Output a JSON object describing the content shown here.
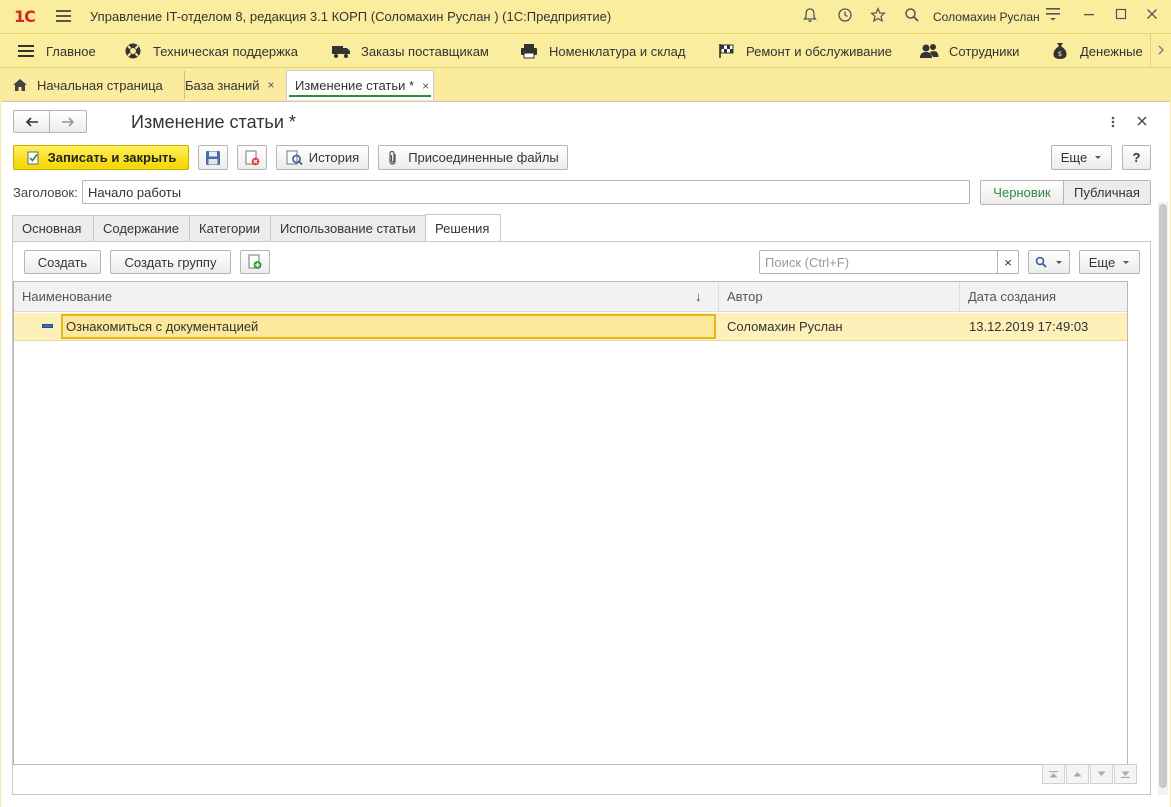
{
  "app": {
    "logo": "1С",
    "title": "Управление IT-отделом 8, редакция 3.1 КОРП (Соломахин Руслан )  (1С:Предприятие)",
    "user": "Соломахин Руслан"
  },
  "sections": [
    {
      "label": "Главное",
      "icon": "menu-icon"
    },
    {
      "label": "Техническая поддержка",
      "icon": "lifebuoy-icon"
    },
    {
      "label": "Заказы поставщикам",
      "icon": "truck-icon"
    },
    {
      "label": "Номенклатура и склад",
      "icon": "printer-icon"
    },
    {
      "label": "Ремонт и обслуживание",
      "icon": "flag-icon"
    },
    {
      "label": "Сотрудники",
      "icon": "people-icon"
    },
    {
      "label": "Денежные",
      "icon": "money-bag-icon"
    }
  ],
  "open_tabs": [
    {
      "label": "Начальная страница"
    },
    {
      "label": "База знаний",
      "close": "×"
    },
    {
      "label": "Изменение статьи *",
      "close": "×"
    }
  ],
  "form": {
    "title": "Изменение статьи *",
    "save_close": "Записать и закрыть",
    "history": "История",
    "attached_files": "Присоединенные файлы",
    "more": "Еще",
    "help": "?",
    "heading_label": "Заголовок:",
    "heading_value": "Начало работы",
    "status_draft": "Черновик",
    "status_public": "Публичная",
    "colors": {
      "accent": "#f4d600",
      "selection": "#fdf0b9",
      "draft_green": "#2e8b3e"
    }
  },
  "form_tabs": [
    "Основная",
    "Содержание",
    "Категории",
    "Использование статьи",
    "Решения"
  ],
  "list": {
    "create": "Создать",
    "create_group": "Создать группу",
    "search_placeholder": "Поиск (Ctrl+F)",
    "search_clear": "×",
    "more": "Еще",
    "columns": [
      "Наименование",
      "Автор",
      "Дата создания"
    ],
    "sort_arrow": "↓",
    "rows": [
      {
        "name": "Ознакомиться с документацией",
        "author": "Соломахин Руслан",
        "created": "13.12.2019 17:49:03"
      }
    ]
  }
}
